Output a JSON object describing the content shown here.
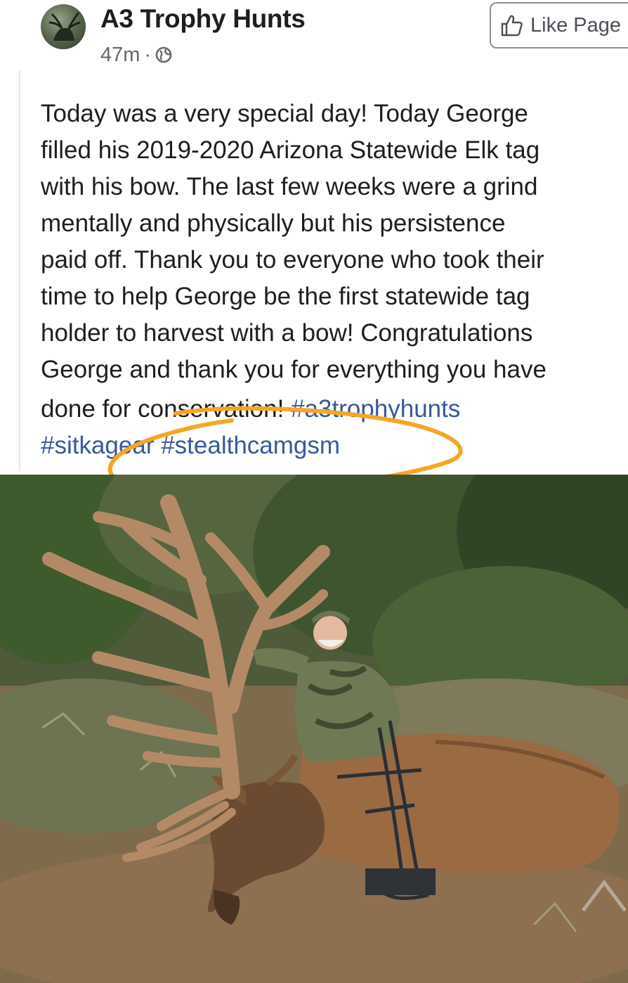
{
  "post": {
    "page_name": "A3 Trophy Hunts",
    "time_ago": "47m",
    "separator": "·",
    "privacy_icon": "globe-icon",
    "like_button_label": "Like Page",
    "like_icon": "thumbs-up-icon",
    "text": "Today was a very special day! Today George\nfilled his 2019-2020 Arizona Statewide Elk tag\nwith his bow. The last few weeks were a grind\nmentally and physically but his persistence\npaid off. Thank you to everyone who took their\ntime to help George be the first statewide tag\nholder to harvest with a bow! Congratulations\nGeorge and thank you for everything you have",
    "text_tail": "done for conservation! ",
    "hashtags": [
      "#a3trophyhunts",
      "#sitkagear",
      "#stealthcamgsm"
    ]
  },
  "annotation": {
    "color": "#f5a623"
  },
  "colors": {
    "link": "#385898",
    "secondary_text": "#65676b"
  }
}
